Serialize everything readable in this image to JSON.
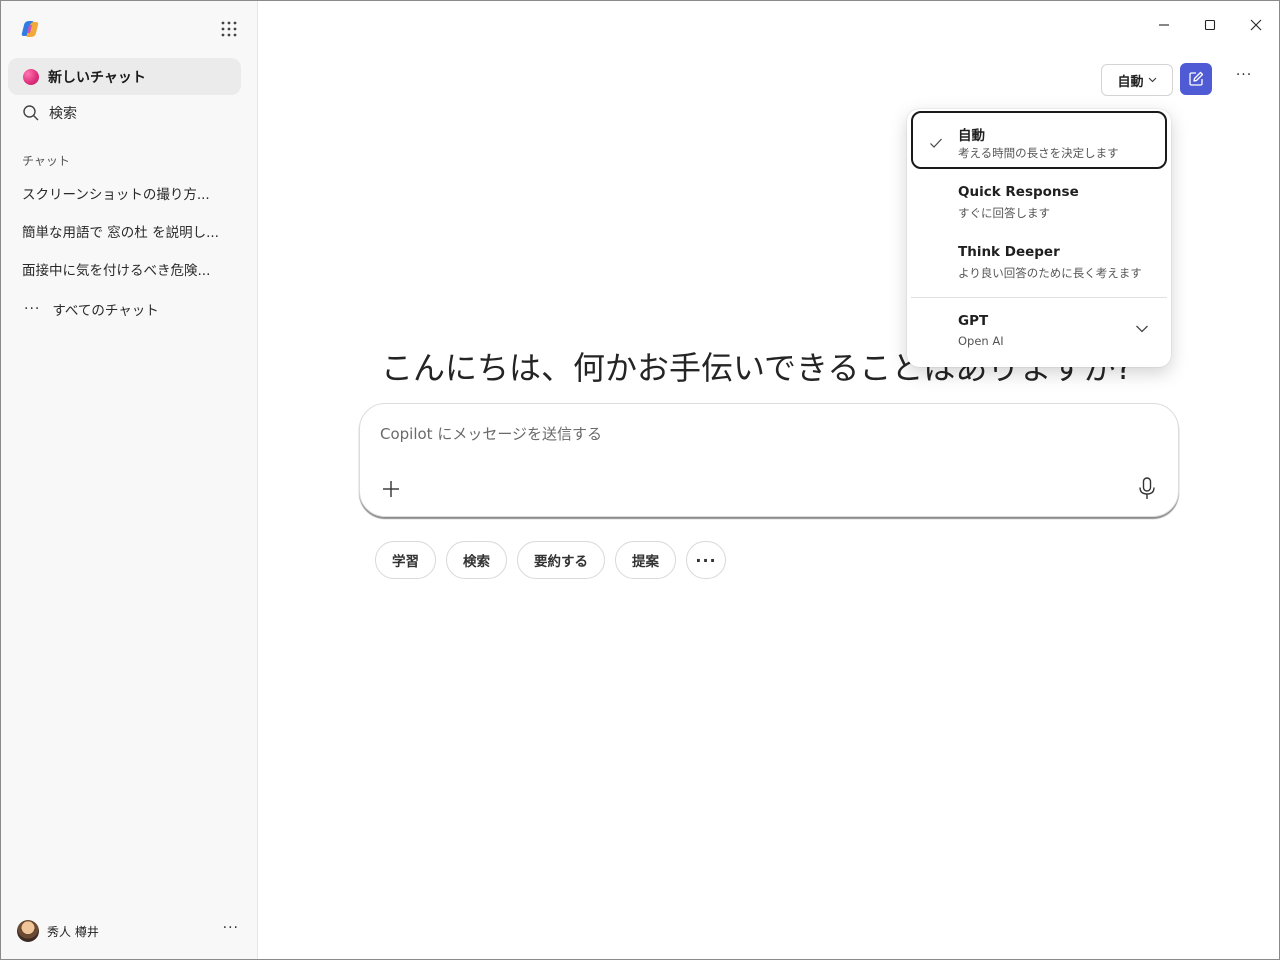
{
  "sidebar": {
    "new_chat": "新しいチャット",
    "search": "検索",
    "section_label": "チャット",
    "chats": [
      "スクリーンショットの撮り方...",
      "簡単な用語で 窓の杜 を説明し...",
      "面接中に気を付けるべき危険..."
    ],
    "all_chats": "すべてのチャット",
    "user_name": "秀人 樽井"
  },
  "toolbar": {
    "mode_label": "自動"
  },
  "main": {
    "greeting": "こんにちは、何かお手伝いできることはありますか?",
    "composer_placeholder": "Copilot にメッセージを送信する",
    "chips": [
      "学習",
      "検索",
      "要約する",
      "提案"
    ]
  },
  "dropdown": {
    "options": [
      {
        "title": "自動",
        "subtitle": "考える時間の長さを決定します",
        "selected": true
      },
      {
        "title": "Quick Response",
        "subtitle": "すぐに回答します",
        "selected": false
      },
      {
        "title": "Think Deeper",
        "subtitle": "より良い回答のために長く考えます",
        "selected": false
      }
    ],
    "model": {
      "title": "GPT",
      "subtitle": "Open AI"
    }
  },
  "colors": {
    "accent": "#4f5bd5",
    "sidebar_bg": "#f8f8f8",
    "selected_row_bg": "#ebebeb"
  },
  "icons": [
    "copilot-logo-icon",
    "apps-grid-icon",
    "search-icon",
    "minimize-icon",
    "maximize-icon",
    "close-icon",
    "chevron-down-icon",
    "compose-icon",
    "more-icon",
    "plus-icon",
    "microphone-icon",
    "checkmark-icon"
  ]
}
